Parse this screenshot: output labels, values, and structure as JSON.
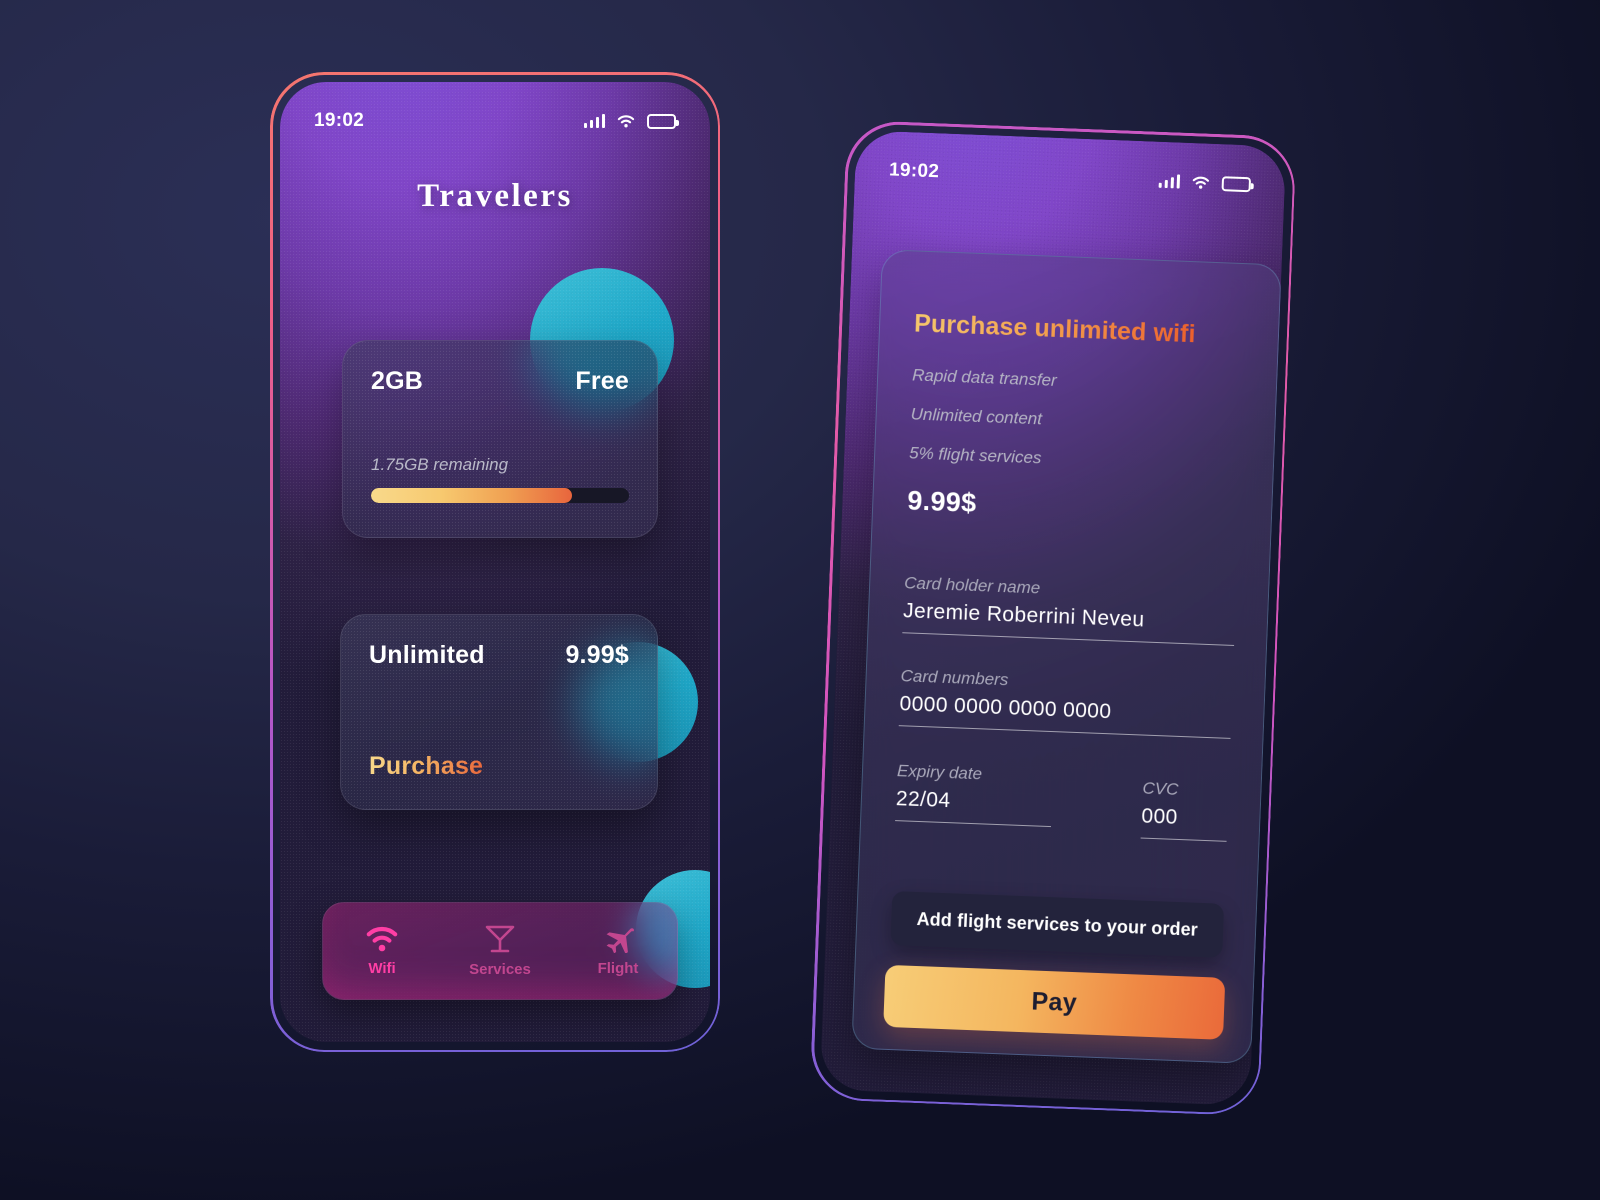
{
  "phone1": {
    "status": {
      "time": "19:02",
      "signal_icon": "signal-bars-icon",
      "wifi_icon": "wifi-icon",
      "battery_icon": "battery-icon"
    },
    "title": "Travelers",
    "free_card": {
      "plan": "2GB",
      "price": "Free",
      "remaining": "1.75GB remaining",
      "progress_percent": 78
    },
    "unlimited_card": {
      "plan": "Unlimited",
      "price": "9.99$",
      "action": "Purchase"
    },
    "tabbar": {
      "items": [
        {
          "label": "Wifi",
          "icon": "wifi-icon",
          "active": true
        },
        {
          "label": "Services",
          "icon": "cocktail-glass-icon",
          "active": false
        },
        {
          "label": "Flight",
          "icon": "airplane-icon",
          "active": false
        }
      ]
    }
  },
  "phone2": {
    "status": {
      "time": "19:02",
      "signal_icon": "signal-bars-icon",
      "wifi_icon": "wifi-icon",
      "battery_icon": "battery-icon"
    },
    "title": "Purchase unlimited wifi",
    "features": [
      "Rapid data transfer",
      "Unlimited content",
      "5% flight services"
    ],
    "price": "9.99$",
    "form": {
      "card_holder": {
        "label": "Card holder name",
        "value": "Jeremie Roberrini Neveu"
      },
      "card_numbers": {
        "label": "Card numbers",
        "value": "0000  0000  0000  0000"
      },
      "expiry": {
        "label": "Expiry date",
        "value": "22/04"
      },
      "cvc": {
        "label": "CVC",
        "value": "000"
      }
    },
    "secondary_button": "Add flight services to your order",
    "pay_button": "Pay"
  },
  "colors": {
    "background": "#1a1c38",
    "accent_orange": "#ef8a45",
    "accent_gold": "#f7cd77",
    "accent_pink": "#ff3ea5",
    "accent_teal": "#29b0cc",
    "frame_pink": "#ef5f86",
    "frame_purple": "#6f62d8"
  }
}
